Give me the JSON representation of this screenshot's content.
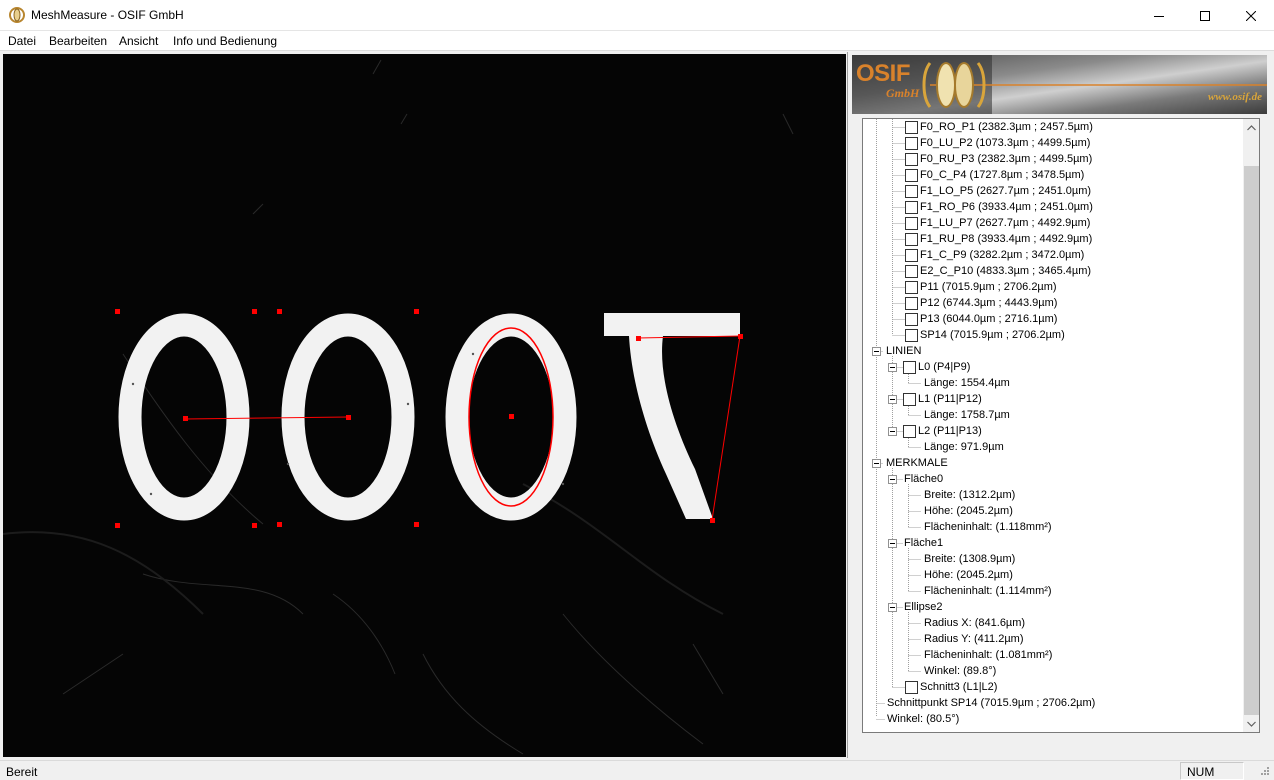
{
  "window": {
    "title": "MeshMeasure - OSIF GmbH",
    "icon": "osif-app-icon",
    "controls": {
      "minimize": "minimize-icon",
      "maximize": "maximize-icon",
      "close": "close-icon"
    }
  },
  "menu": [
    "Datei",
    "Bearbeiten",
    "Ansicht",
    "Info und Bedienung"
  ],
  "logo": {
    "name": "OSIF",
    "sub": "GmbH",
    "url": "www.osif.de",
    "color": "#d9822b"
  },
  "image": {
    "digits": "0007",
    "background": "#050505",
    "marker_color": "#ff0000"
  },
  "tree": {
    "points": [
      "F0_RO_P1 (2382.3µm ; 2457.5µm)",
      "F0_LU_P2 (1073.3µm ; 4499.5µm)",
      "F0_RU_P3 (2382.3µm ; 4499.5µm)",
      "F0_C_P4 (1727.8µm ; 3478.5µm)",
      "F1_LO_P5 (2627.7µm ; 2451.0µm)",
      "F1_RO_P6 (3933.4µm ; 2451.0µm)",
      "F1_LU_P7 (2627.7µm ; 4492.9µm)",
      "F1_RU_P8 (3933.4µm ; 4492.9µm)",
      "F1_C_P9 (3282.2µm ; 3472.0µm)",
      "E2_C_P10 (4833.3µm ; 3465.4µm)",
      "P11 (7015.9µm ; 2706.2µm)",
      "P12 (6744.3µm ; 4443.9µm)",
      "P13 (6044.0µm ; 2716.1µm)",
      "SP14 (7015.9µm ; 2706.2µm)"
    ],
    "lines_label": "LINIEN",
    "lines": [
      {
        "label": "L0 (P4|P9)",
        "length": "Länge: 1554.4µm"
      },
      {
        "label": "L1 (P11|P12)",
        "length": "Länge: 1758.7µm"
      },
      {
        "label": "L2 (P11|P13)",
        "length": "Länge: 971.9µm"
      }
    ],
    "features_label": "MERKMALE",
    "features": [
      {
        "label": "Fläche0",
        "props": [
          "Breite: (1312.2µm)",
          "Höhe: (2045.2µm)",
          "Flächeninhalt: (1.118mm²)"
        ]
      },
      {
        "label": "Fläche1",
        "props": [
          "Breite: (1308.9µm)",
          "Höhe: (2045.2µm)",
          "Flächeninhalt: (1.114mm²)"
        ]
      },
      {
        "label": "Ellipse2",
        "props": [
          "Radius X: (841.6µm)",
          "Radius Y: (411.2µm)",
          "Flächeninhalt: (1.081mm²)",
          "Winkel: (89.8°)"
        ]
      }
    ],
    "intersection": "Schnitt3 (L1|L2)",
    "intersection_point": "Schnittpunkt SP14 (7015.9µm ; 2706.2µm)",
    "angle": "Winkel: (80.5°)"
  },
  "status": {
    "text": "Bereit",
    "num": "NUM"
  }
}
